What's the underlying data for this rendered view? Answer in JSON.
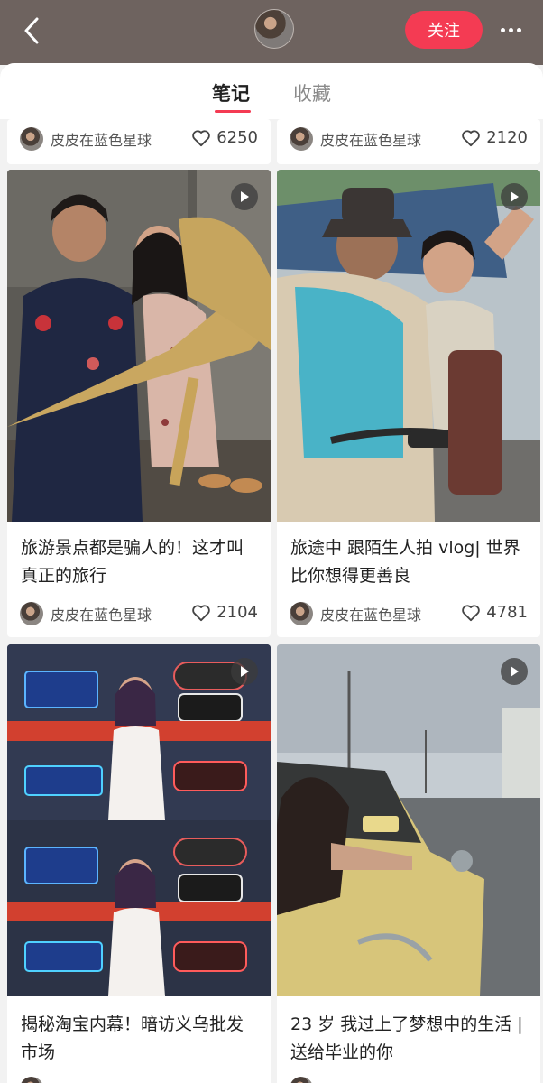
{
  "header": {
    "follow_label": "关注",
    "icons": {
      "back": "back-chevron-icon",
      "more": "more-dots-icon"
    }
  },
  "tabs": [
    {
      "label": "笔记",
      "active": true
    },
    {
      "label": "收藏",
      "active": false
    }
  ],
  "accent_color": "#f43b53",
  "partial_row": [
    {
      "author": "皮皮在蓝色星球",
      "likes": "6250"
    },
    {
      "author": "皮皮在蓝色星球",
      "likes": "2120"
    }
  ],
  "notes": [
    {
      "title": "旅游景点都是骗人的！这才叫真正的旅行",
      "author": "皮皮在蓝色星球",
      "likes": "2104",
      "video": true
    },
    {
      "title": "旅途中 跟陌生人拍 vlog| 世界比你想得更善良",
      "author": "皮皮在蓝色星球",
      "likes": "4781",
      "video": true
    },
    {
      "title": "揭秘淘宝内幕！暗访义乌批发市场",
      "author": "",
      "likes": "",
      "video": true
    },
    {
      "title": "23 岁 我过上了梦想中的生活 | 送给毕业的你",
      "author": "",
      "likes": "",
      "video": true
    }
  ]
}
